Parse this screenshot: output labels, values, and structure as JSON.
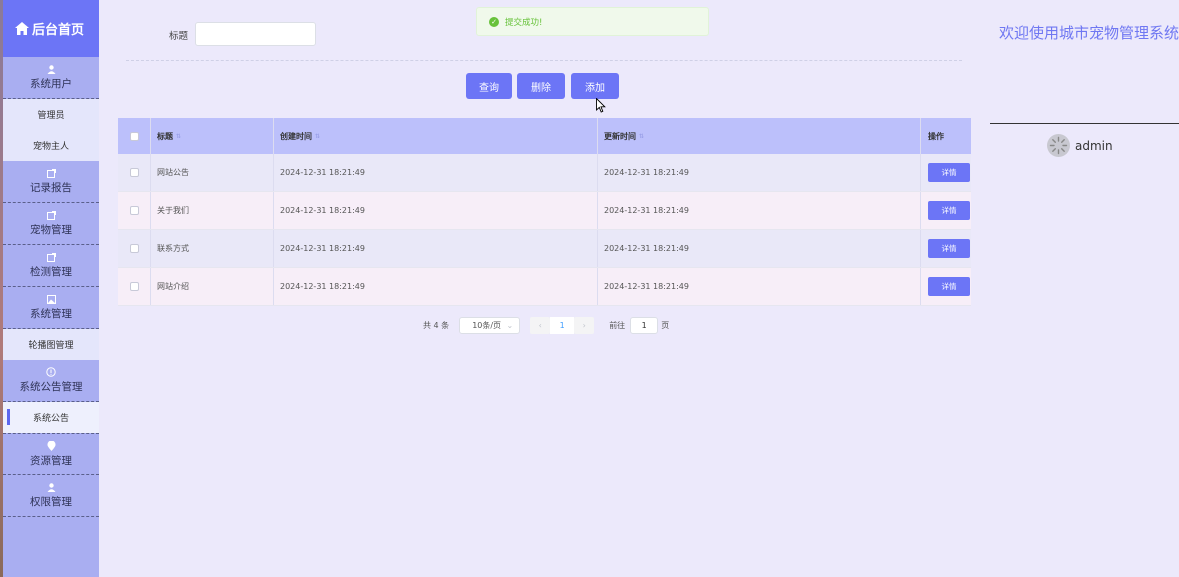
{
  "brand": {
    "title": "后台首页",
    "icon": "home-icon"
  },
  "sidebar": {
    "groups": [
      {
        "label": "系统用户",
        "icon": "user-icon",
        "items": [
          "管理员",
          "宠物主人"
        ]
      },
      {
        "label": "记录报告",
        "icon": "edit-icon",
        "items": []
      },
      {
        "label": "宠物管理",
        "icon": "edit-icon",
        "items": []
      },
      {
        "label": "检测管理",
        "icon": "edit-icon",
        "items": []
      },
      {
        "label": "系统管理",
        "icon": "picture-icon",
        "items": [
          "轮播图管理"
        ]
      },
      {
        "label": "系统公告管理",
        "icon": "info-icon",
        "items": [
          "系统公告"
        ]
      },
      {
        "label": "资源管理",
        "icon": "location-icon",
        "items": []
      },
      {
        "label": "权限管理",
        "icon": "user-icon",
        "items": []
      }
    ]
  },
  "search": {
    "label": "标题",
    "value": ""
  },
  "toolbar": {
    "query": "查询",
    "delete": "删除",
    "add": "添加"
  },
  "toast": {
    "message": "提交成功!"
  },
  "table": {
    "headers": {
      "title": "标题",
      "created": "创建时间",
      "updated": "更新时间",
      "op": "操作"
    },
    "rows": [
      {
        "title": "网站公告",
        "created": "2024-12-31 18:21:49",
        "updated": "2024-12-31 18:21:49",
        "action": "详情"
      },
      {
        "title": "关于我们",
        "created": "2024-12-31 18:21:49",
        "updated": "2024-12-31 18:21:49",
        "action": "详情"
      },
      {
        "title": "联系方式",
        "created": "2024-12-31 18:21:49",
        "updated": "2024-12-31 18:21:49",
        "action": "详情"
      },
      {
        "title": "网站介绍",
        "created": "2024-12-31 18:21:49",
        "updated": "2024-12-31 18:21:49",
        "action": "详情"
      }
    ]
  },
  "pagination": {
    "total": "共 4 条",
    "page_size": "10条/页",
    "current_page": "1",
    "goto_label": "前往",
    "goto_value": "1",
    "page_unit": "页"
  },
  "header": {
    "welcome": "欢迎使用城市宠物管理系统",
    "username": "admin"
  },
  "colors": {
    "accent": "#6c75f6",
    "sidebar": "#a9aef1",
    "background": "#ece9fb"
  }
}
